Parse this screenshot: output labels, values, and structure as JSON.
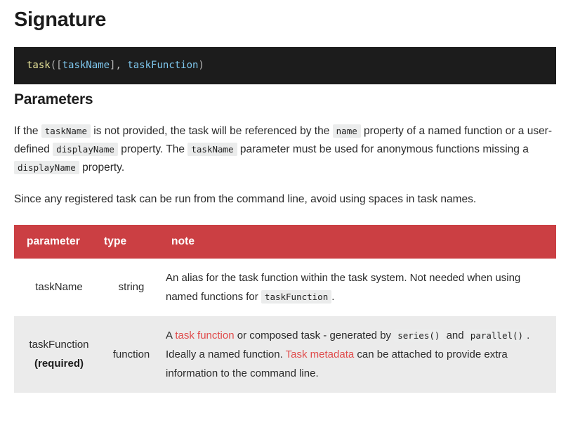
{
  "sections": {
    "signature": {
      "heading": "Signature",
      "code": {
        "fn": "task",
        "open_paren": "(",
        "open_bracket": "[",
        "arg1": "taskName",
        "close_bracket": "]",
        "comma": ", ",
        "arg2": "taskFunction",
        "close_paren": ")"
      }
    },
    "parameters": {
      "heading": "Parameters",
      "paragraph1": {
        "t1": "If the ",
        "c1": "taskName",
        "t2": " is not provided, the task will be referenced by the ",
        "c2": "name",
        "t3": " property of a named function or a user-defined ",
        "c3": "displayName",
        "t4": " property. The ",
        "c4": "taskName",
        "t5": " parameter must be used for anonymous functions missing a ",
        "c5": "displayName",
        "t6": " property."
      },
      "paragraph2": "Since any registered task can be run from the command line, avoid using spaces in task names."
    }
  },
  "table": {
    "columns": {
      "parameter": "parameter",
      "type": "type",
      "note": "note"
    },
    "rows": [
      {
        "parameter": "taskName",
        "required_label": "",
        "type": "string",
        "note": {
          "t1": "An alias for the task function within the task system. Not needed when using named functions for ",
          "c1": "taskFunction",
          "t2": "."
        }
      },
      {
        "parameter": "taskFunction",
        "required_label": "(required)",
        "type": "function",
        "note": {
          "t1": "A ",
          "link1": "task function",
          "t2": " or composed task - generated by ",
          "c1": "series()",
          "t3": " and ",
          "c2": "parallel()",
          "t4": ". Ideally a named function. ",
          "link2": "Task metadata",
          "t5": " can be attached to provide extra information to the command line."
        }
      }
    ]
  },
  "theme": {
    "table_header_bg": "#cb3f43",
    "link_color": "#e04b4b",
    "code_block_bg": "#1c1c1c",
    "inline_code_bg": "#ebecec",
    "row_even_bg": "#ebebeb",
    "code_fn_color": "#e8e49a",
    "code_var_color": "#7fc8ef",
    "code_punct_color": "#b9b9b9"
  }
}
